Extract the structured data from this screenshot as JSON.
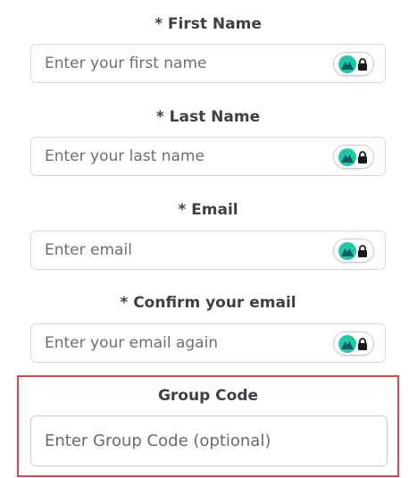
{
  "form": {
    "fields": [
      {
        "label": "* First Name",
        "placeholder": "Enter your first name"
      },
      {
        "label": "* Last Name",
        "placeholder": "Enter your last name"
      },
      {
        "label": "* Email",
        "placeholder": "Enter email"
      },
      {
        "label": "* Confirm your email",
        "placeholder": "Enter your email again"
      }
    ],
    "group_code": {
      "label": "Group Code",
      "placeholder": "Enter Group Code (optional)"
    }
  },
  "colors": {
    "highlight_border": "#e0474c",
    "password_manager_logo": "#1fc8a8"
  },
  "icons": {
    "password_manager": "password-manager-logo-icon",
    "lock": "lock-icon"
  }
}
